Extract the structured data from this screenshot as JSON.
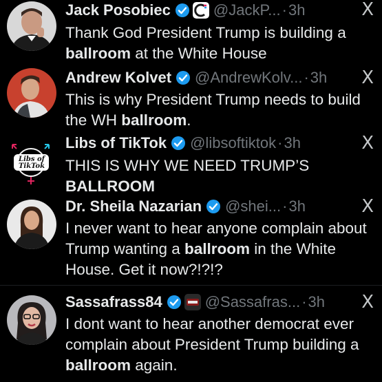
{
  "colors": {
    "background": "#000000",
    "text": "#e7e9ea",
    "muted": "#71767b",
    "verified": "#1d9bf0"
  },
  "close_glyph": "X",
  "tweets": [
    {
      "name": "Jack Posobiec",
      "handle": "@JackP...",
      "time": "3h",
      "text_parts": [
        "Thank God President Trump is building a ",
        "ballroom",
        " at the White House"
      ],
      "avatar_icon": "avatar-jack-posobiec",
      "has_affiliate_badge": true
    },
    {
      "name": "Andrew Kolvet",
      "handle": "@AndrewKolv...",
      "time": "3h",
      "text_parts": [
        "This is why President Trump needs to build the WH ",
        "ballroom",
        "."
      ],
      "avatar_icon": "avatar-andrew-kolvet"
    },
    {
      "name": "Libs of TikTok",
      "handle": "@libsoftiktok",
      "time": "3h",
      "text_parts": [
        "THIS IS WHY WE NEED TRUMP’S ",
        "BALLROOM",
        ""
      ],
      "avatar_icon": "libs-of-tiktok-logo",
      "logo_text_1": "Libs of",
      "logo_text_2": "TikTok"
    },
    {
      "name": "Dr. Sheila Nazarian",
      "handle": "@shei...",
      "time": "3h",
      "text_parts": [
        "I never want to hear anyone complain about Trump wanting a ",
        "ballroom",
        " in the White House. Get it now?!?!?"
      ],
      "avatar_icon": "avatar-sheila-nazarian"
    },
    {
      "name": "Sassafrass84",
      "handle": "@Sassafras...",
      "time": "3h",
      "text_parts": [
        "I dont want to hear another democrat ever complain about President Trump building a ",
        "ballroom",
        " again."
      ],
      "avatar_icon": "avatar-sassafrass84",
      "has_affiliate_badge": true
    }
  ]
}
